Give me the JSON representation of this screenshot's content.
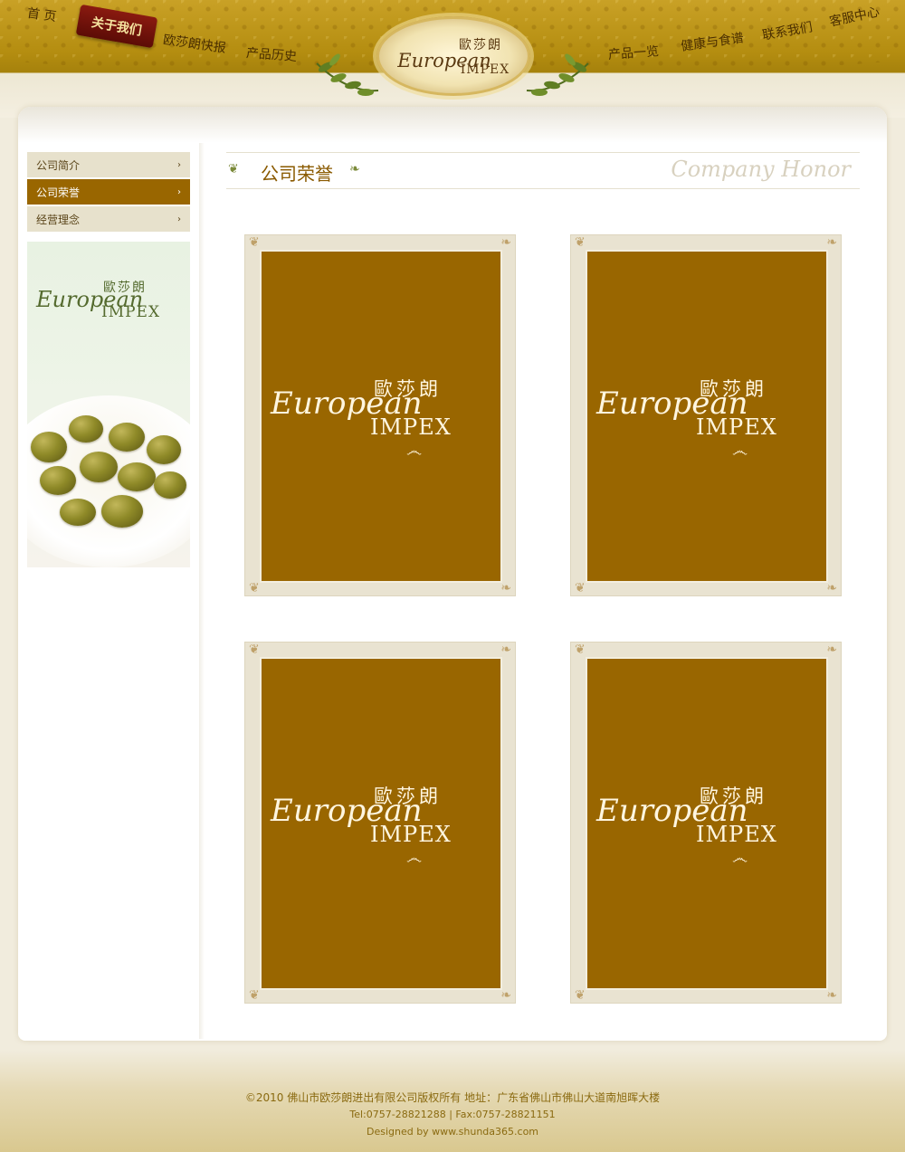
{
  "nav": {
    "home": "首  页",
    "about": "关于我们",
    "news": "欧莎朗快报",
    "history": "产品历史",
    "products": "产品一览",
    "health": "健康与食谱",
    "contact": "联系我们",
    "service": "客服中心"
  },
  "logo": {
    "cn": "歐莎朗",
    "en": "European",
    "impex": "IMPEX"
  },
  "sidebar": {
    "items": [
      {
        "label": "公司简介",
        "active": false
      },
      {
        "label": "公司荣誉",
        "active": true
      },
      {
        "label": "经营理念",
        "active": false
      }
    ],
    "chevron": "›",
    "banner": {
      "cn": "歐莎朗",
      "en": "European",
      "impex": "IMPEX"
    }
  },
  "section": {
    "title_cn": "公司荣誉",
    "title_en": "Company Honor"
  },
  "certificates": [
    {
      "cn": "歐莎朗",
      "en": "European",
      "impex": "IMPEX"
    },
    {
      "cn": "歐莎朗",
      "en": "European",
      "impex": "IMPEX"
    },
    {
      "cn": "歐莎朗",
      "en": "European",
      "impex": "IMPEX"
    },
    {
      "cn": "歐莎朗",
      "en": "European",
      "impex": "IMPEX"
    }
  ],
  "footer": {
    "copyright": "©2010  佛山市欧莎朗进出有限公司版权所有    地址：广东省佛山市佛山大道南旭晖大楼",
    "contact": "Tel:0757-28821288 | Fax:0757-28821151",
    "designed": "Designed by www.shunda365.com"
  },
  "colors": {
    "accent": "#996600",
    "header_gold": "#b48d10",
    "sidebar_bg": "#e7e1cc",
    "frame": "#e9e3d1"
  }
}
